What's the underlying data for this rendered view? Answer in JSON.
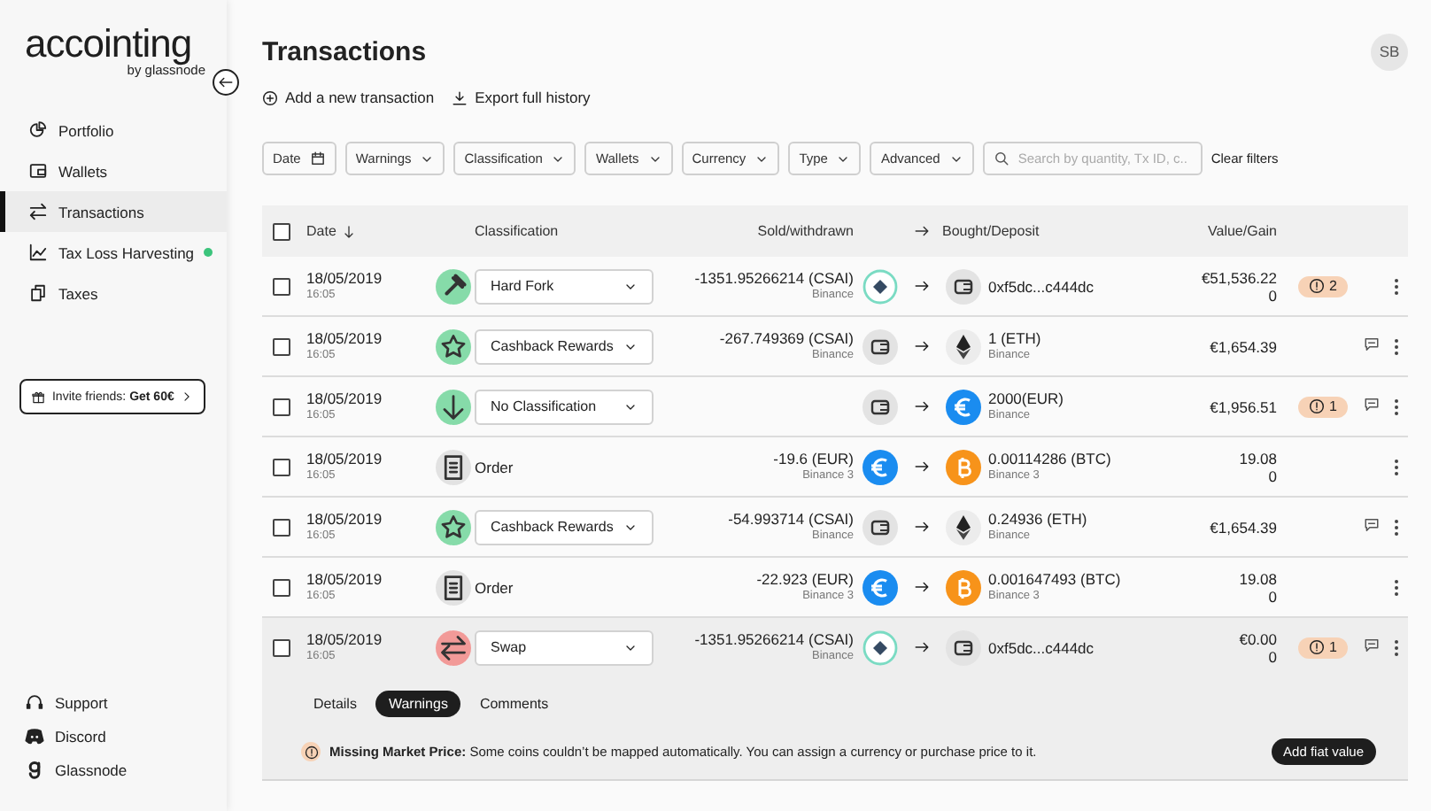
{
  "sidebar": {
    "logo": "accointing",
    "logo_sub": "by glassnode",
    "nav": [
      {
        "label": "Portfolio",
        "selected": false,
        "dot": false
      },
      {
        "label": "Wallets",
        "selected": false,
        "dot": false
      },
      {
        "label": "Transactions",
        "selected": true,
        "dot": false
      },
      {
        "label": "Tax Loss Harvesting",
        "selected": false,
        "dot": true
      },
      {
        "label": "Taxes",
        "selected": false,
        "dot": false
      }
    ],
    "invite": "Invite friends: **Get 60€**",
    "footer": [
      {
        "label": "Support"
      },
      {
        "label": "Discord"
      },
      {
        "label": "Glassnode"
      }
    ]
  },
  "page": {
    "title": "Transactions",
    "avatar": "SB",
    "actions": [
      "Add a new transaction",
      "Export full history"
    ]
  },
  "filters": [
    {
      "label": "Date",
      "kind": "date"
    },
    {
      "label": "Warnings",
      "kind": "dropdown"
    },
    {
      "label": "Classification",
      "kind": "dropdown"
    },
    {
      "label": "Wallets",
      "kind": "dropdown"
    },
    {
      "label": "Currency",
      "kind": "dropdown"
    },
    {
      "label": "Type",
      "kind": "dropdown"
    },
    {
      "label": "Advanced",
      "kind": "dropdown"
    }
  ],
  "search": {
    "placeholder": "Search by quantity, Tx ID, c.."
  },
  "clear_filters": "Clear filters",
  "table": {
    "select_all_checked": false,
    "columns": [
      "Date",
      "Classification",
      "Sold/withdrawn",
      "Bought/Deposit",
      "Value/Gain"
    ],
    "rows": [
      {
        "kind": "hardfork",
        "checked": false,
        "date": "18/05/2019",
        "time": "16:05",
        "classification": {
          "label": "Hard Fork",
          "kind": "dropdown"
        },
        "sold": {
          "kind": "coin",
          "amount": "-1351.95266214 (CSAI)",
          "source": "Binance"
        },
        "bought": {
          "kind": "wallet",
          "amount": "0xf5dc...c444dc"
        },
        "value": "€51,536.22",
        "gain": "0",
        "warnings": "2",
        "comment": false,
        "expanded": false
      },
      {
        "kind": "cashback",
        "checked": false,
        "date": "18/05/2019",
        "time": "16:05",
        "classification": {
          "label": "Cashback Rewards",
          "kind": "dropdown"
        },
        "sold": {
          "kind": "wallet",
          "amount": "-267.749369 (CSAI)",
          "source": "Binance"
        },
        "bought": {
          "kind": "eth",
          "amount": "1 (ETH)",
          "source": "Binance"
        },
        "value": "€1,654.39",
        "comment": true,
        "expanded": false
      },
      {
        "kind": "deposit",
        "checked": false,
        "date": "18/05/2019",
        "time": "16:05",
        "classification": {
          "label": "No Classification",
          "kind": "dropdown"
        },
        "sold": {
          "kind": "wallet"
        },
        "bought": {
          "kind": "euro",
          "amount": "2000(EUR)",
          "source": "Binance"
        },
        "value": "€1,956.51",
        "warnings": "1",
        "comment": true,
        "expanded": false
      },
      {
        "kind": "order",
        "checked": false,
        "date": "18/05/2019",
        "time": "16:05",
        "classification": {
          "label": "Order",
          "kind": "plain"
        },
        "sold": {
          "kind": "euro",
          "amount": "-19.6 (EUR)",
          "source": "Binance 3"
        },
        "bought": {
          "kind": "btc",
          "amount": "0.00114286 (BTC)",
          "source": "Binance 3"
        },
        "value": "19.08",
        "gain": "0",
        "comment": false,
        "expanded": false
      },
      {
        "kind": "cashback",
        "checked": false,
        "date": "18/05/2019",
        "time": "16:05",
        "classification": {
          "label": "Cashback Rewards",
          "kind": "dropdown"
        },
        "sold": {
          "kind": "wallet",
          "amount": "-54.993714 (CSAI)",
          "source": "Binance"
        },
        "bought": {
          "kind": "eth",
          "amount": "0.24936 (ETH)",
          "source": "Binance"
        },
        "value": "€1,654.39",
        "comment": true,
        "expanded": false
      },
      {
        "kind": "order",
        "checked": false,
        "date": "18/05/2019",
        "time": "16:05",
        "classification": {
          "label": "Order",
          "kind": "plain"
        },
        "sold": {
          "kind": "euro",
          "amount": "-22.923 (EUR)",
          "source": "Binance 3"
        },
        "bought": {
          "kind": "btc",
          "amount": "0.001647493 (BTC)",
          "source": "Binance 3"
        },
        "value": "19.08",
        "gain": "0",
        "comment": false,
        "expanded": false
      },
      {
        "kind": "swap",
        "checked": false,
        "date": "18/05/2019",
        "time": "16:05",
        "classification": {
          "label": "Swap",
          "kind": "dropdown"
        },
        "sold": {
          "kind": "coin",
          "amount": "-1351.95266214 (CSAI)",
          "source": "Binance"
        },
        "bought": {
          "kind": "wallet",
          "amount": "0xf5dc...c444dc"
        },
        "value": "€0.00",
        "gain": "0",
        "warnings": "1",
        "comment": true,
        "expanded": true,
        "details": {
          "tabs": [
            {
              "label": "Details",
              "selected": false
            },
            {
              "label": "Warnings",
              "selected": true
            },
            {
              "label": "Comments",
              "selected": false
            }
          ],
          "message": "**Missing Market Price:** Some coins couldn’t be mapped automatically. You can assign a currency or purchase price to it.",
          "action": "Add fiat value"
        }
      }
    ]
  }
}
